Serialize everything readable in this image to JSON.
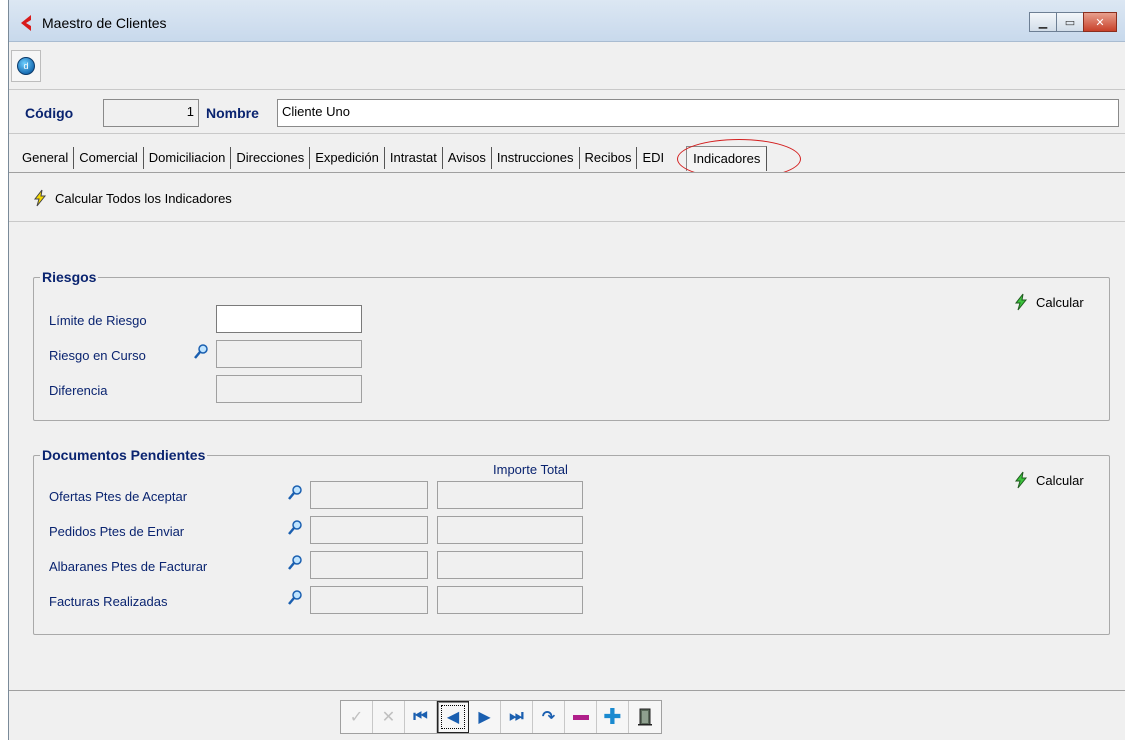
{
  "window": {
    "title": "Maestro de Clientes",
    "buttons": [
      "minimize",
      "maximize",
      "close"
    ]
  },
  "header": {
    "codigo_label": "Código",
    "codigo_value": "1",
    "nombre_label": "Nombre",
    "nombre_value": "Cliente Uno"
  },
  "tabs": [
    {
      "label": "General"
    },
    {
      "label": "Comercial"
    },
    {
      "label": "Domiciliacion"
    },
    {
      "label": "Direcciones"
    },
    {
      "label": "Expedición"
    },
    {
      "label": "Intrastat"
    },
    {
      "label": "Avisos"
    },
    {
      "label": "Instrucciones"
    },
    {
      "label": "Recibos"
    },
    {
      "label": "EDI"
    },
    {
      "label": "Indicadores",
      "active": true
    }
  ],
  "toolbar": {
    "calc_all_label": "Calcular Todos los Indicadores"
  },
  "riesgos": {
    "title": "Riesgos",
    "calc_label": "Calcular",
    "rows": [
      {
        "label": "Límite de Riesgo"
      },
      {
        "label": "Riesgo en Curso"
      },
      {
        "label": "Diferencia"
      }
    ]
  },
  "documentos": {
    "title": "Documentos Pendientes",
    "calc_label": "Calcular",
    "col_header": "Importe Total",
    "rows": [
      {
        "label": "Ofertas Ptes de Aceptar"
      },
      {
        "label": "Pedidos Ptes de Enviar"
      },
      {
        "label": "Albaranes Ptes de Facturar"
      },
      {
        "label": "Facturas Realizadas"
      }
    ]
  },
  "nav": {
    "buttons": [
      "confirm",
      "cancel",
      "first",
      "prior",
      "next",
      "last",
      "refresh",
      "delete",
      "insert",
      "exit"
    ]
  },
  "colors": {
    "label_blue": "#0a2470",
    "accent_green": "#2e9e2e",
    "highlight_ring": "#d32020"
  }
}
